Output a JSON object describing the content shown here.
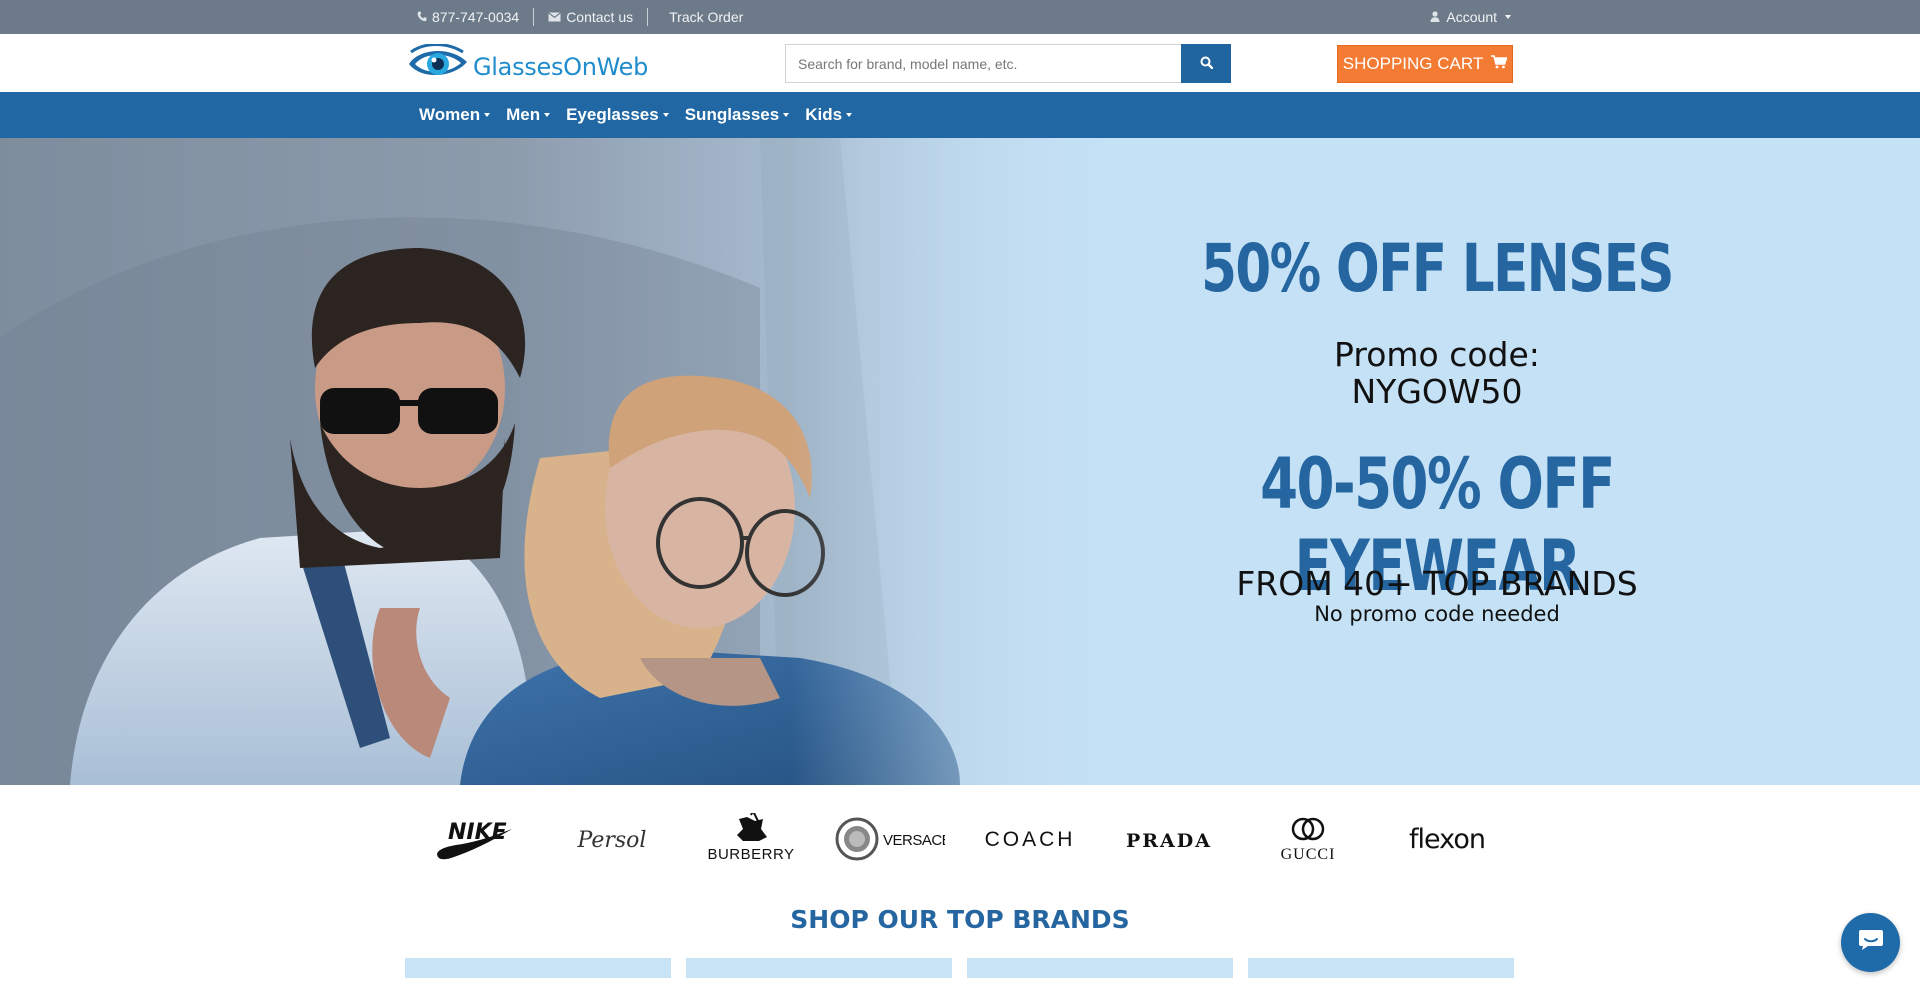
{
  "topbar": {
    "phone_icon": "phone-icon",
    "phone": "877-747-0034",
    "contact_icon": "envelope-icon",
    "contact": "Contact us",
    "track": "Track Order",
    "account_icon": "user-icon",
    "account": "Account"
  },
  "header": {
    "logo_text": "GlassesOnWeb",
    "logo_icon": "eye-icon",
    "search_placeholder": "Search for brand, model name, etc.",
    "search_icon": "search-icon",
    "cart_label": "SHOPPING CART",
    "cart_icon": "cart-icon"
  },
  "nav": {
    "items": [
      {
        "label": "Women"
      },
      {
        "label": "Men"
      },
      {
        "label": "Eyeglasses"
      },
      {
        "label": "Sunglasses"
      },
      {
        "label": "Kids"
      }
    ]
  },
  "hero": {
    "headline1": "50% OFF LENSES",
    "promo_line1": "Promo code:",
    "promo_line2": "NYGOW50",
    "headline2": "40-50% OFF EYEWEAR",
    "from_text": "FROM 40+ TOP BRANDS",
    "no_code_text": "No promo code needed"
  },
  "brands": [
    "NIKE",
    "Persol",
    "BURBERRY",
    "VERSACE",
    "COACH",
    "PRADA",
    "GUCCI",
    "flexon"
  ],
  "shop_title": "SHOP OUR TOP BRANDS",
  "chat": {
    "icon": "chat-icon"
  },
  "colors": {
    "topbar": "#6c7a89",
    "nav": "#2067a3",
    "accent": "#2566a1",
    "cart": "#f47b33",
    "hero_bg": "#c5e1f6"
  }
}
